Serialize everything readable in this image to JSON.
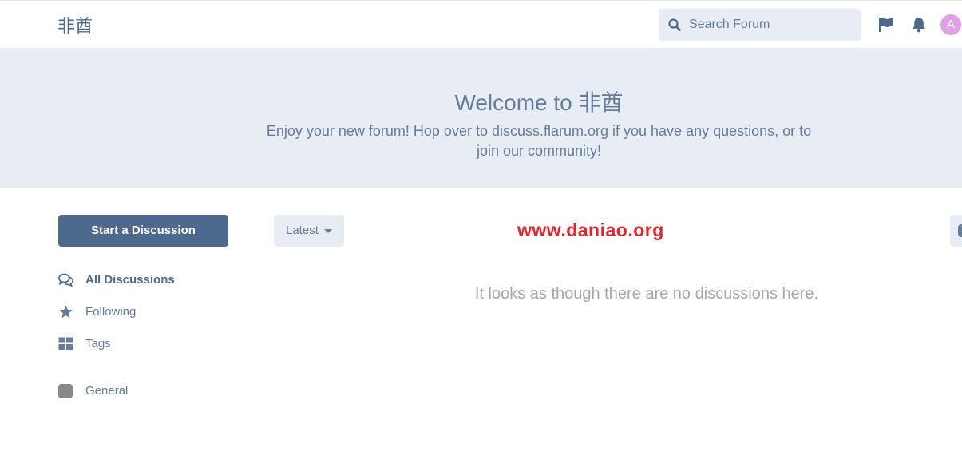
{
  "header": {
    "logo": "非酋",
    "search_placeholder": "Search Forum",
    "avatar_letter": "A",
    "icons": [
      "search-icon",
      "flag-icon",
      "bell-icon"
    ]
  },
  "hero": {
    "title": "Welcome to 非酋",
    "description": "Enjoy your new forum! Hop over to discuss.flarum.org if you have any questions, or to join our community!"
  },
  "sidebar": {
    "start_button": "Start a Discussion",
    "nav": [
      {
        "label": "All Discussions",
        "icon": "comments-icon",
        "active": true
      },
      {
        "label": "Following",
        "icon": "star-icon",
        "active": false
      },
      {
        "label": "Tags",
        "icon": "grid-icon",
        "active": false
      }
    ],
    "tags": [
      {
        "label": "General",
        "color": "#888888"
      }
    ]
  },
  "toolbar": {
    "sort_label": "Latest"
  },
  "watermark": "www.daniao.org",
  "empty_message": "It looks as though there are no discussions here.",
  "colors": {
    "primary": "#4d698e",
    "text": "#667c99",
    "panel": "#e7edf3",
    "watermark": "#e8222b",
    "avatar": "#e0a0e6"
  }
}
